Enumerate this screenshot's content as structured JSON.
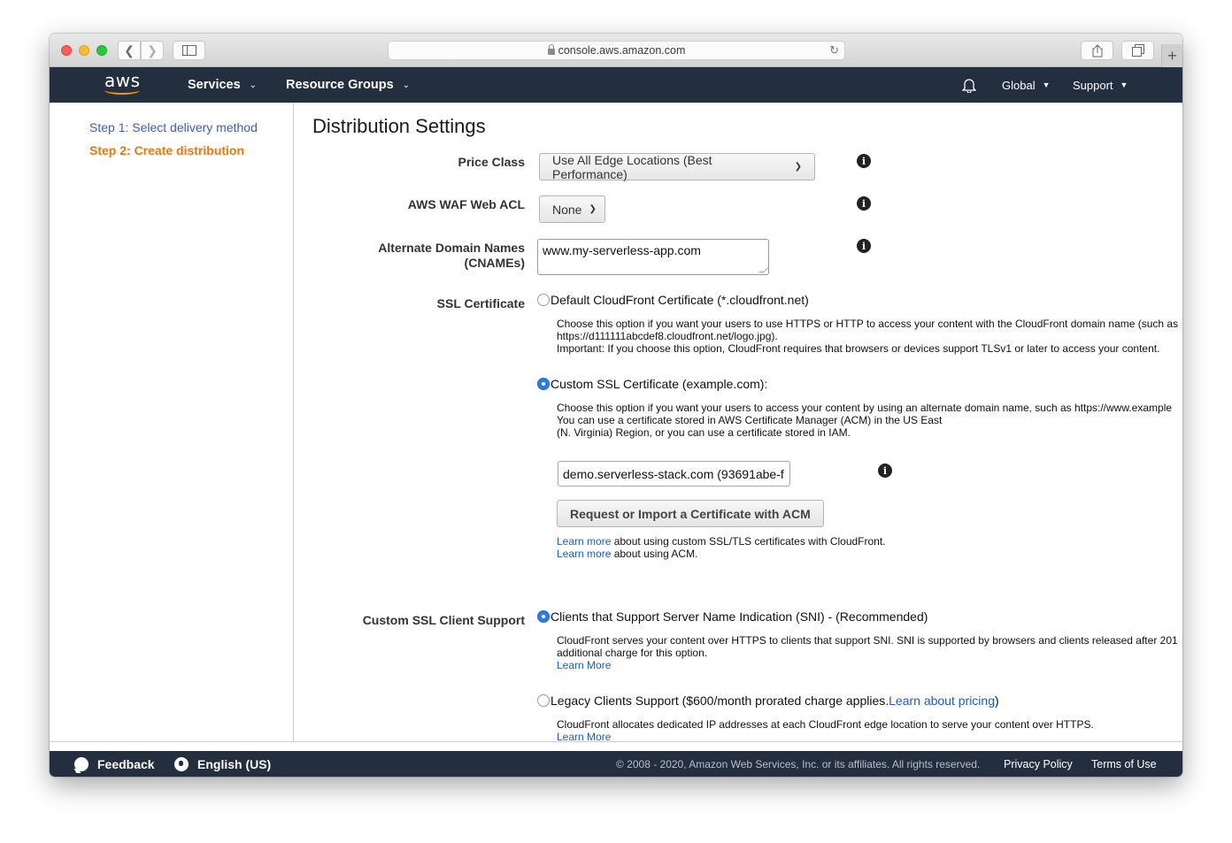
{
  "browser": {
    "url": "console.aws.amazon.com",
    "icons": {
      "back": "chevron-left-icon",
      "forward": "chevron-right-icon",
      "sidebar": "sidebar-icon",
      "reload": "reload-icon",
      "share": "share-icon",
      "tabs": "tabs-icon",
      "new_tab": "plus-icon",
      "lock": "lock-icon"
    }
  },
  "nav": {
    "logo": "aws",
    "services": "Services",
    "resource_groups": "Resource Groups",
    "region": "Global",
    "support": "Support"
  },
  "steps": [
    {
      "label": "Step 1: Select delivery method",
      "active": false
    },
    {
      "label": "Step 2: Create distribution",
      "active": true
    }
  ],
  "main": {
    "title": "Distribution Settings",
    "price_class": {
      "label": "Price Class",
      "value": "Use All Edge Locations (Best Performance)"
    },
    "waf": {
      "label": "AWS WAF Web ACL",
      "value": "None"
    },
    "cnames": {
      "label_line1": "Alternate Domain Names",
      "label_line2": "(CNAMEs)",
      "value": "www.my-serverless-app.com"
    },
    "ssl": {
      "label": "SSL Certificate",
      "default_option": {
        "label": "Default CloudFront Certificate (*.cloudfront.net)",
        "selected": false,
        "desc_line1": "Choose this option if you want your users to use HTTPS or HTTP to access your content with the CloudFront domain name (such as",
        "desc_line2": "https://d111111abcdef8.cloudfront.net/logo.jpg).",
        "desc_line3": "Important: If you choose this option, CloudFront requires that browsers or devices support TLSv1 or later to access your content."
      },
      "custom_option": {
        "label": "Custom SSL Certificate (example.com):",
        "selected": true,
        "desc_line1": "Choose this option if you want your users to access your content by using an alternate domain name, such as https://www.example",
        "desc_line2": "You can use a certificate stored in AWS Certificate Manager (ACM) in the US East",
        "desc_line3": "(N. Virginia) Region, or you can use a certificate stored in IAM."
      },
      "certificate_value": "demo.serverless-stack.com (93691abe-f",
      "acm_button": "Request or Import a Certificate with ACM",
      "learn_more_1_link": "Learn more",
      "learn_more_1_text": " about using custom SSL/TLS certificates with CloudFront.",
      "learn_more_2_link": "Learn more",
      "learn_more_2_text": " about using ACM."
    },
    "client_support": {
      "label": "Custom SSL Client Support",
      "sni_option": {
        "label": "Clients that Support Server Name Indication (SNI) - (Recommended)",
        "selected": true,
        "desc_line1": "CloudFront serves your content over HTTPS to clients that support SNI. SNI is supported by browsers and clients released after 201",
        "desc_line2": "additional charge for this option.",
        "learn_more": "Learn More"
      },
      "legacy_option": {
        "label_prefix": "Legacy Clients Support ($600/month prorated charge applies. ",
        "label_link": "Learn about pricing",
        "label_suffix": ")",
        "selected": false,
        "desc_line1": "CloudFront allocates dedicated IP addresses at each CloudFront edge location to serve your content over HTTPS.",
        "learn_more": "Learn More"
      }
    }
  },
  "footer": {
    "feedback": "Feedback",
    "language": "English (US)",
    "copyright": "© 2008 - 2020, Amazon Web Services, Inc. or its affiliates. All rights reserved.",
    "privacy": "Privacy Policy",
    "terms": "Terms of Use"
  },
  "colors": {
    "nav_bg": "#232f3e",
    "accent_orange": "#e47911",
    "link_blue": "#1c60c4",
    "radio_selected": "#2b7bf0"
  }
}
